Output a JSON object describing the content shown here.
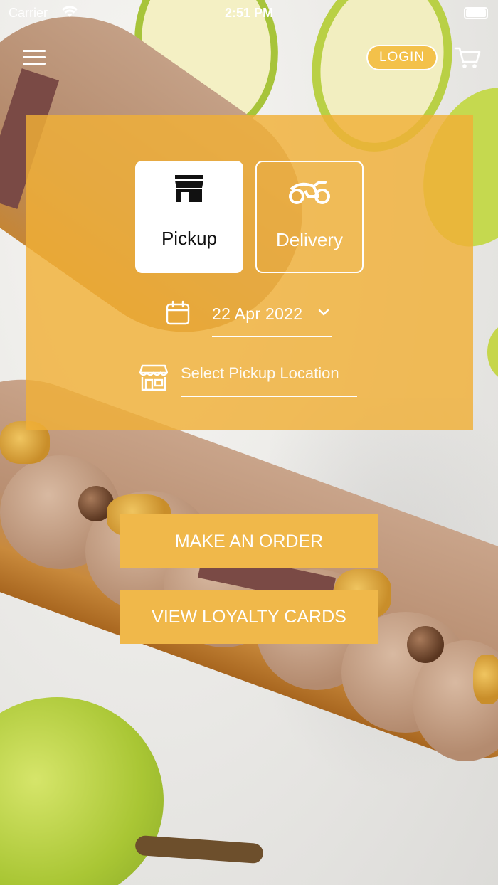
{
  "status_bar": {
    "carrier": "Carrier",
    "time": "2:51 PM"
  },
  "header": {
    "menu_icon": "hamburger-menu-icon",
    "login_label": "LOGIN",
    "cart_icon": "cart-icon"
  },
  "order_panel": {
    "modes": [
      {
        "label": "Pickup",
        "icon": "store-icon",
        "selected": true
      },
      {
        "label": "Delivery",
        "icon": "motorbike-icon",
        "selected": false
      }
    ],
    "date": {
      "icon": "calendar-icon",
      "value": "22 Apr 2022",
      "dropdown_icon": "chevron-down-icon"
    },
    "location": {
      "icon": "storefront-icon",
      "placeholder": "Select Pickup Location"
    },
    "panel_color": "#F0B037"
  },
  "actions": {
    "make_order_label": "MAKE AN ORDER",
    "loyalty_label": "VIEW LOYALTY CARDS",
    "button_color": "#F0B84A"
  }
}
